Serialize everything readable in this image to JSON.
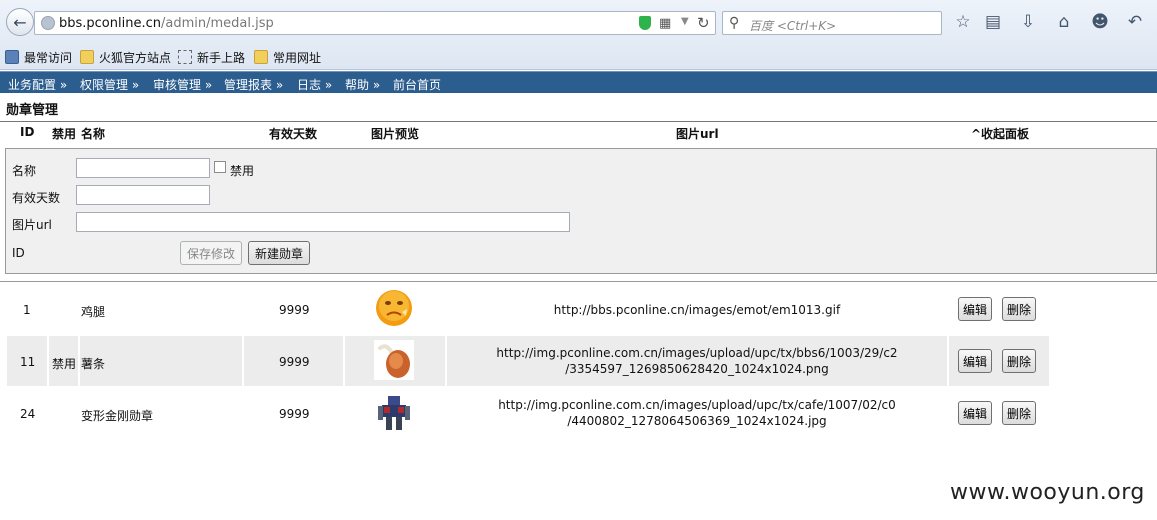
{
  "browser": {
    "url_host": "bbs.pconline.cn",
    "url_path": "/admin/medal.jsp",
    "search_placeholder": "百度 <Ctrl+K>",
    "bookmarks": [
      "最常访问",
      "火狐官方站点",
      "新手上路",
      "常用网址"
    ]
  },
  "menu": {
    "items": [
      "业务配置 »",
      "权限管理 »",
      "审核管理 »",
      "管理报表 »",
      "日志 »",
      "帮助 »",
      "前台首页"
    ]
  },
  "page": {
    "title": "勋章管理",
    "columns": {
      "id": "ID",
      "disabled": "禁用",
      "name": "名称",
      "days": "有效天数",
      "preview": "图片预览",
      "url": "图片url",
      "collapse": "^收起面板"
    }
  },
  "form": {
    "name_label": "名称",
    "disabled_label": "禁用",
    "days_label": "有效天数",
    "url_label": "图片url",
    "id_label": "ID",
    "name_value": "",
    "days_value": "",
    "url_value": "",
    "save_label": "保存修改",
    "new_label": "新建勋章"
  },
  "rows": [
    {
      "id": "1",
      "disabled": "",
      "name": "鸡腿",
      "days": "9999",
      "url_line1": "http://bbs.pconline.cn/images/emot/em1013.gif",
      "url_line2": "",
      "thumb": "smiley-face-image",
      "edit": "编辑",
      "delete": "删除"
    },
    {
      "id": "11",
      "disabled": "禁用",
      "name": "薯条",
      "days": "9999",
      "url_line1": "http://img.pconline.com.cn/images/upload/upc/tx/bbs6/1003/29/c2",
      "url_line2": "/3354597_1269850628420_1024x1024.png",
      "thumb": "chicken-leg-image",
      "edit": "编辑",
      "delete": "删除"
    },
    {
      "id": "24",
      "disabled": "",
      "name": "变形金刚勋章",
      "days": "9999",
      "url_line1": "http://img.pconline.com.cn/images/upload/upc/tx/cafe/1007/02/c0",
      "url_line2": "/4400802_1278064506369_1024x1024.jpg",
      "thumb": "transformer-robot-image",
      "edit": "编辑",
      "delete": "删除"
    }
  ],
  "watermark": "www.wooyun.org",
  "colors": {
    "menubar": "#2c5d8f",
    "shaded_row": "#ececec",
    "panel": "#f0f0f0"
  }
}
